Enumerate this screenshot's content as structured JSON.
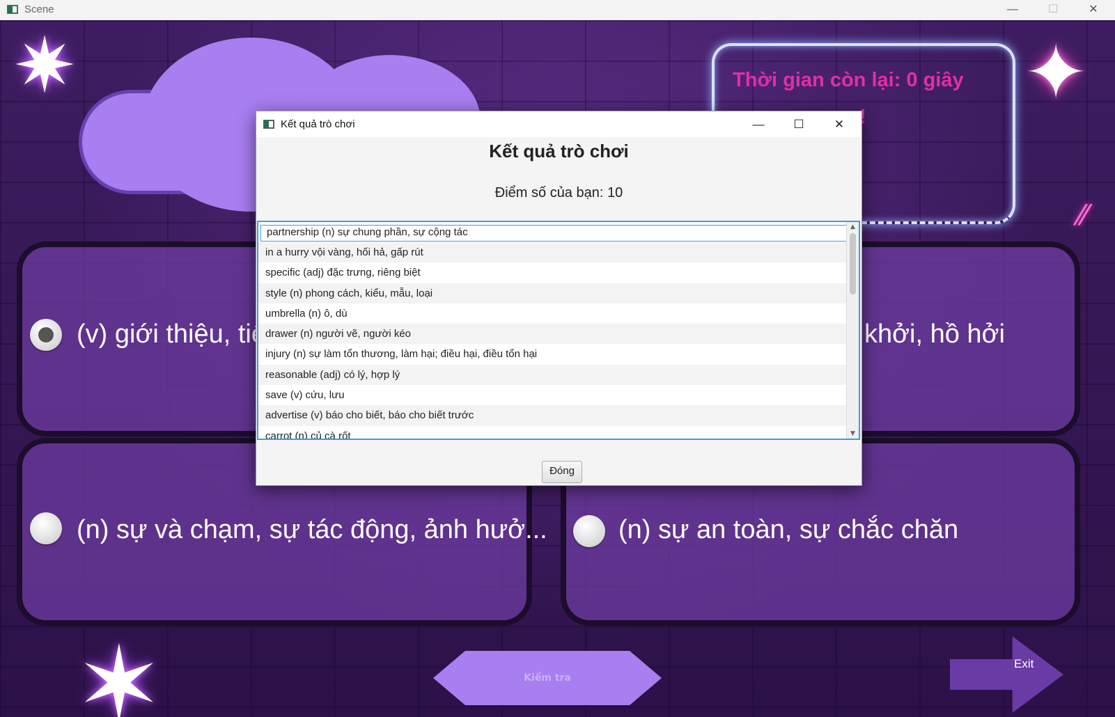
{
  "window": {
    "title": "Scene",
    "minimize": "—",
    "maximize": "☐",
    "close": "✕"
  },
  "game": {
    "timer_label": "Thời gian còn lại: 0 giây",
    "timer_partial": "!",
    "options": [
      {
        "text": "(v) giới thiệu, tiế",
        "selected": true
      },
      {
        "text": "khởi, hồ hởi",
        "selected": false
      },
      {
        "text": "(n) sự và chạm, sự tác động, ảnh hưở...",
        "selected": false
      },
      {
        "text": "(n) sự an toàn, sự chắc chăn",
        "selected": false
      }
    ],
    "check_button": "Kiểm tra",
    "exit_button": "Exit"
  },
  "dialog": {
    "title": "Kết quả trò chơi",
    "heading": "Kết quả trò chơi",
    "score": "Điểm số của bạn: 10",
    "items": [
      "partnership (n) sự chung phần, sự cộng tác",
      "in a hurry vội vàng, hối hả, gấp rút",
      "specific (adj) đặc trưng, riêng biệt",
      "style (n) phong cách, kiểu, mẫu, loại",
      "umbrella (n) ô, dù",
      "drawer (n) người vẽ, người kéo",
      "injury (n) sự làm tổn thương, làm hại; điều hại, điều tổn hại",
      "reasonable (adj) có lý, hợp lý",
      "save (v) cứu, lưu",
      "advertise (v) báo cho biết, báo cho biết trước",
      "carrot (n) củ cà rốt"
    ],
    "close_button": "Đóng",
    "minimize": "—",
    "maximize": "☐",
    "close": "✕"
  },
  "colors": {
    "accent": "#a87ef0",
    "timer": "#e02fa6",
    "list_border": "#3aa0d8"
  }
}
